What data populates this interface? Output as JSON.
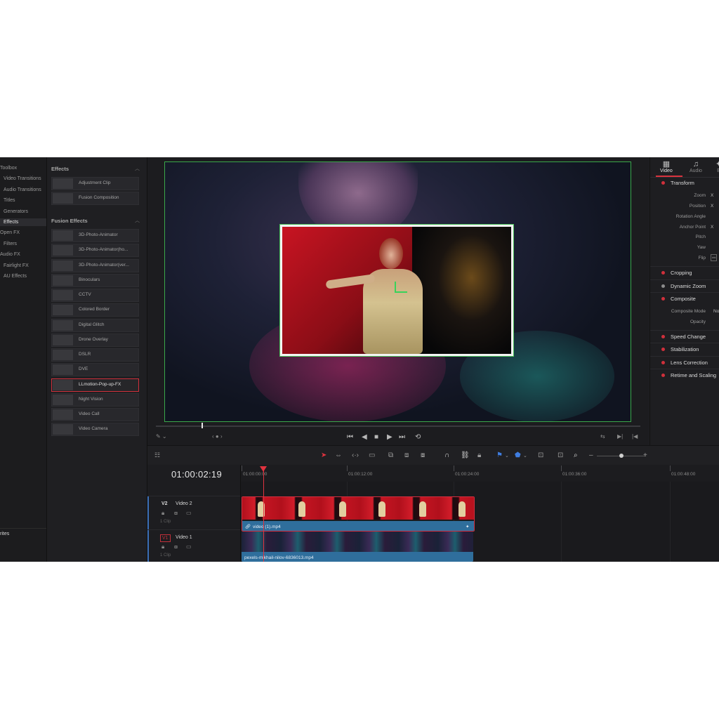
{
  "toolbox": {
    "items": [
      "Toolbox",
      "Video Transitions",
      "Audio Transitions",
      "Titles",
      "Generators",
      "Effects",
      "Open FX",
      "Filters",
      "Audio FX",
      "Fairlight FX",
      "AU Effects"
    ],
    "active": "Effects",
    "footer": "rites"
  },
  "effects_panel": {
    "effects_header": "Effects",
    "effects_items": [
      "Adjustment Clip",
      "Fusion Composition"
    ],
    "fusion_header": "Fusion Effects",
    "fusion_items": [
      "3D-Photo-Animator",
      "3D-Photo-Animator(ho...",
      "3D-Photo-Animator(ver...",
      "Binoculars",
      "CCTV",
      "Colored Border",
      "Digital Glitch",
      "Drone Overlay",
      "DSLR",
      "DVE",
      "LLmotion-Pop-up-FX",
      "Night Vision",
      "Video Call",
      "Video Camera"
    ],
    "selected": "LLmotion-Pop-up-FX"
  },
  "inspector": {
    "tabs": [
      {
        "label": "Video",
        "icon": "film-icon"
      },
      {
        "label": "Audio",
        "icon": "music-note-icon"
      },
      {
        "label": "E",
        "icon": "effects-icon"
      }
    ],
    "transform_header": "Transform",
    "transform_props": [
      "Zoom",
      "Position",
      "Rotation Angle",
      "Anchor Point",
      "Pitch",
      "Yaw",
      "Flip"
    ],
    "transform_values": {
      "zoom": "X",
      "position": "X",
      "anchor": "X"
    },
    "cropping": "Cropping",
    "dynamic_zoom": "Dynamic Zoom",
    "composite_header": "Composite",
    "composite_props": [
      "Composite Mode",
      "Opacity"
    ],
    "composite_mode_value": "No",
    "sections": [
      "Speed Change",
      "Stabilization",
      "Lens Correction",
      "Retime and Scaling"
    ]
  },
  "timeline": {
    "timecode": "01:00:02:19",
    "ruler": [
      "01:00:00:00",
      "01:00:12:00",
      "01:00:24:00",
      "01:00:36:00",
      "01:00:48:00"
    ],
    "tracks": [
      {
        "id": "V2",
        "name": "Video 2",
        "clips": "1 Clip"
      },
      {
        "id": "V1",
        "name": "Video 1",
        "clips": "1 Clip"
      }
    ],
    "clip_v2": "video (1).mp4",
    "clip_v1": "pexels-mikhail-nilov-6836013.mp4"
  },
  "colors": {
    "accent_red": "#e0333f",
    "clip_blue": "#2f6e9c",
    "safe_green": "#3aa84a"
  }
}
